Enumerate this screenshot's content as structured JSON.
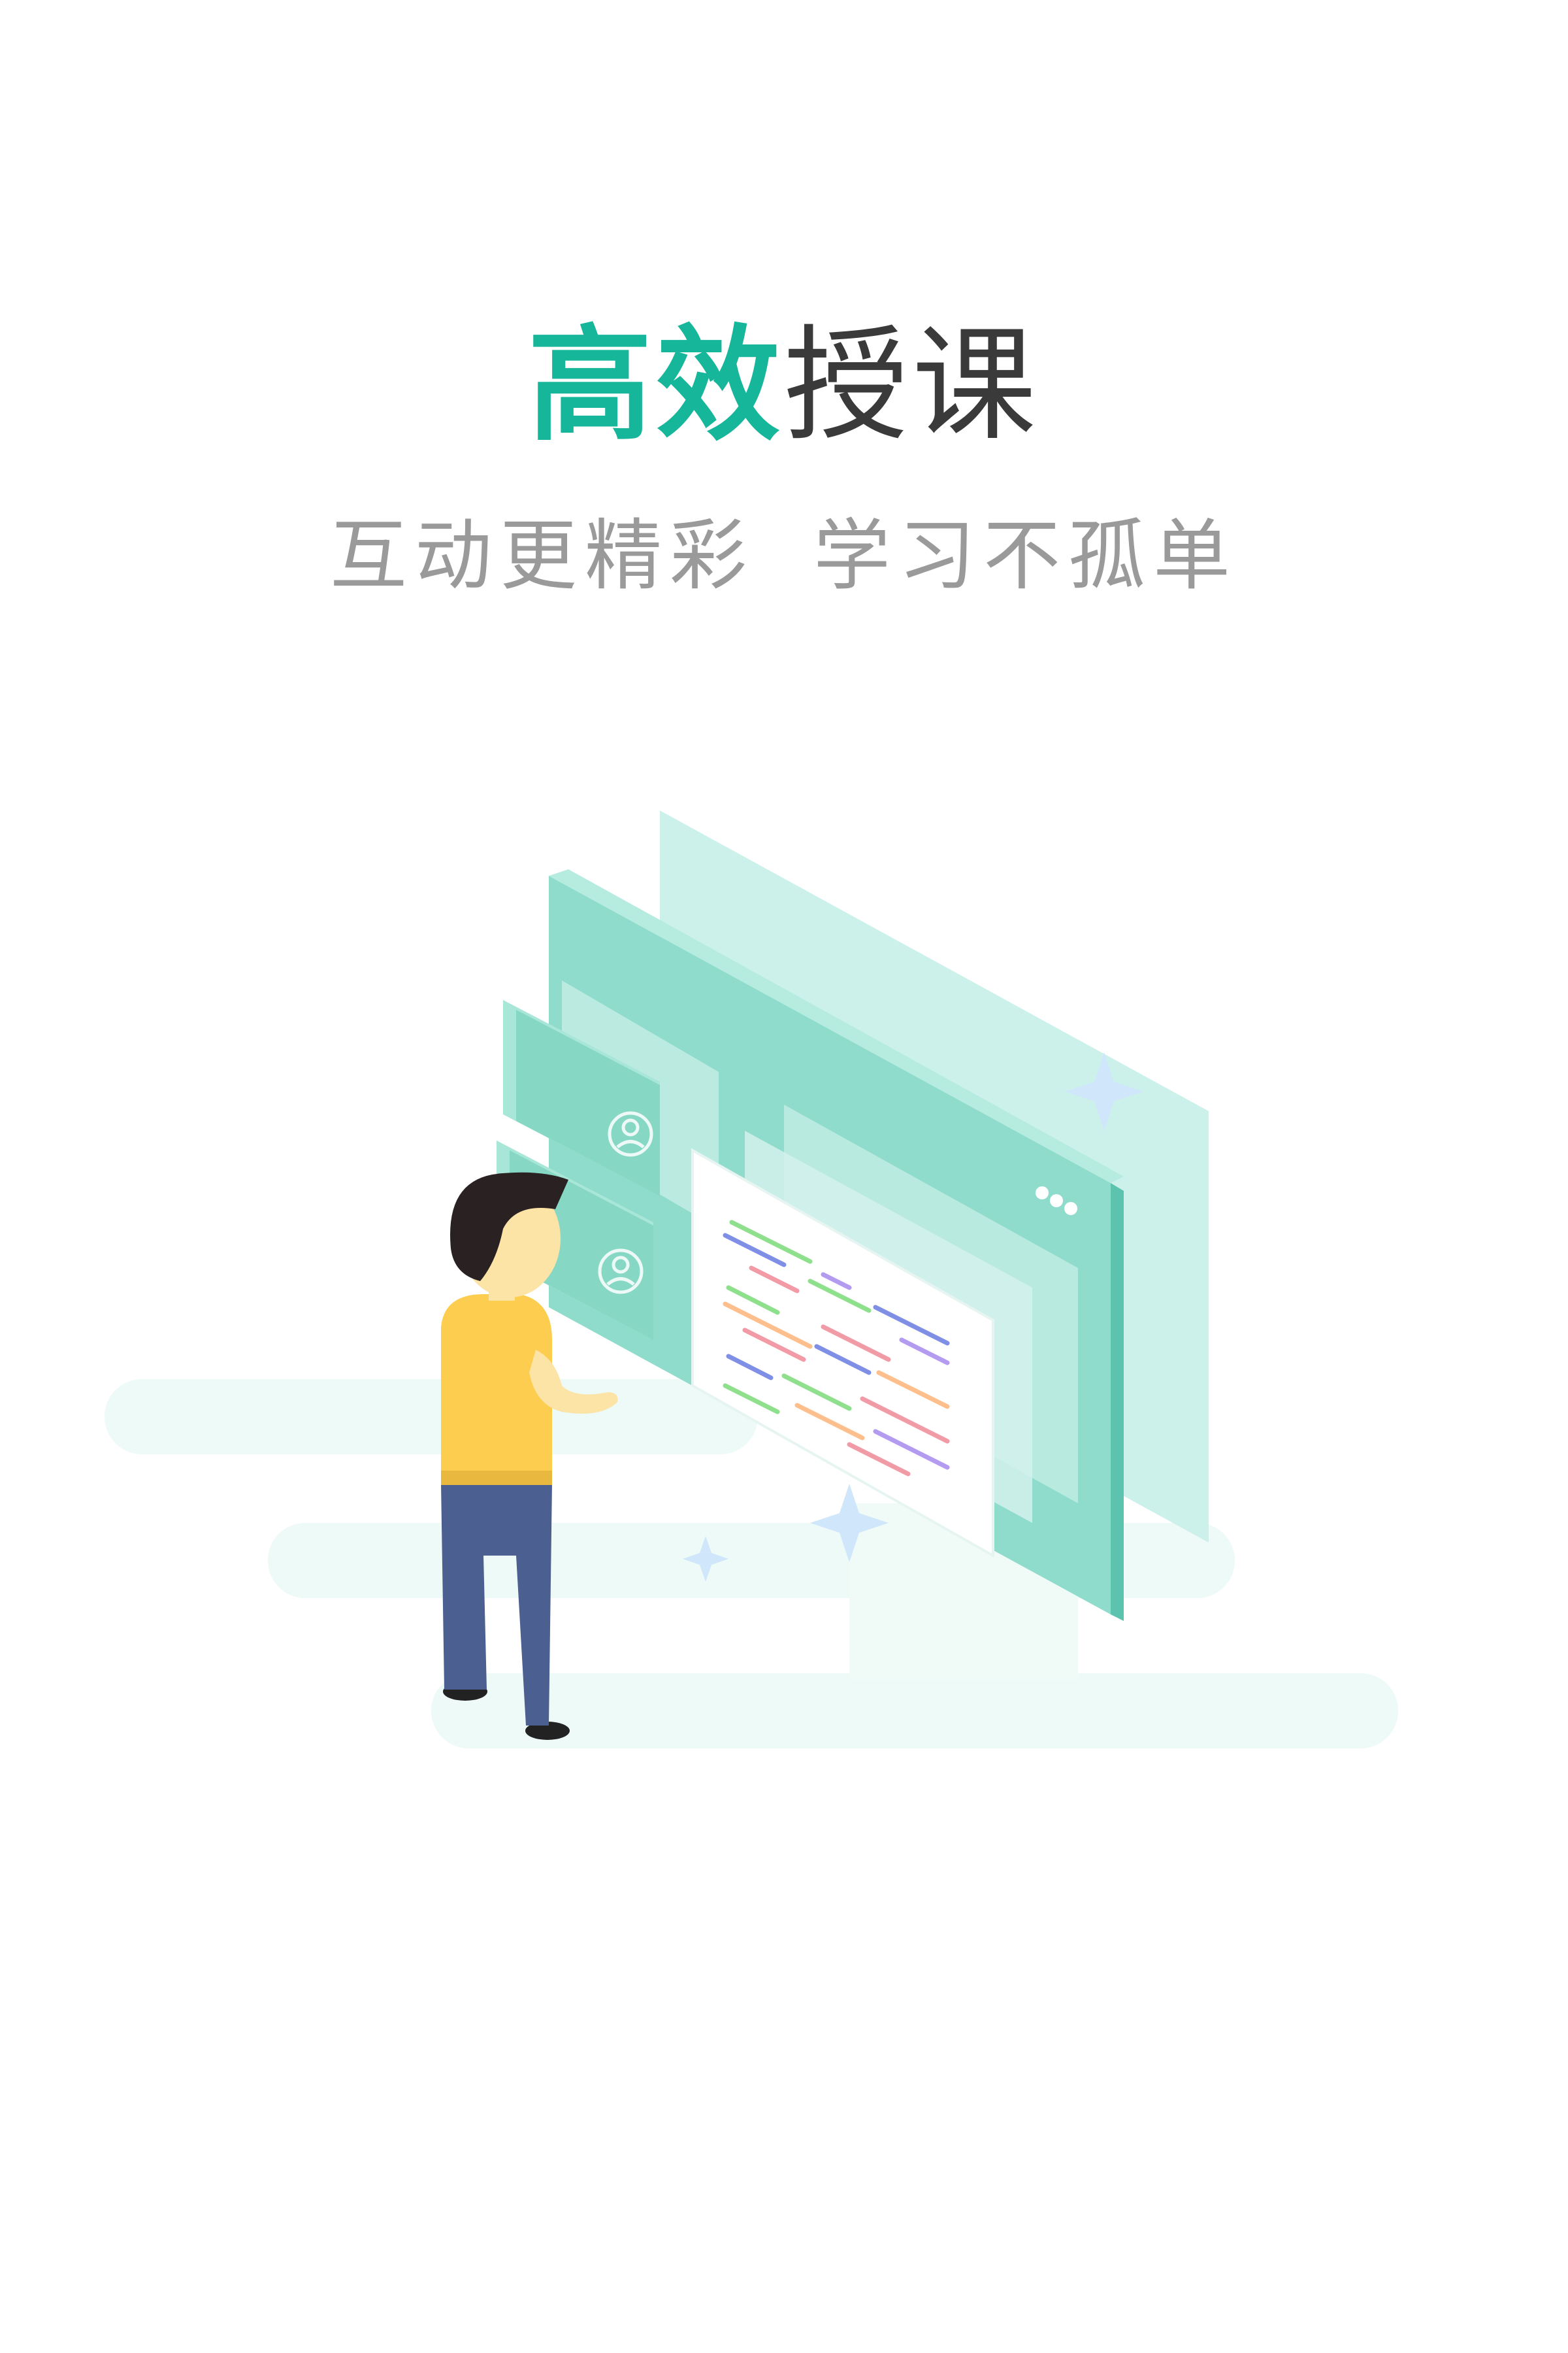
{
  "headline": {
    "accent": "高效",
    "rest": "授课"
  },
  "tagline": {
    "part1": "互动更精彩",
    "part2": "学习不孤单"
  },
  "colors": {
    "accent": "#16b69a",
    "heading": "#3a3a3a",
    "subtext": "#9a9a9a",
    "panel_back": "#c9f0ea",
    "panel_front": "#8fdccc",
    "shirt": "#fdcd4f",
    "pants": "#4c5f91",
    "sparkle": "#cfe6fb"
  },
  "icons": {
    "avatar": "user-circle-icon",
    "sparkle": "sparkle-icon",
    "window_menu": "three-dots-icon"
  }
}
